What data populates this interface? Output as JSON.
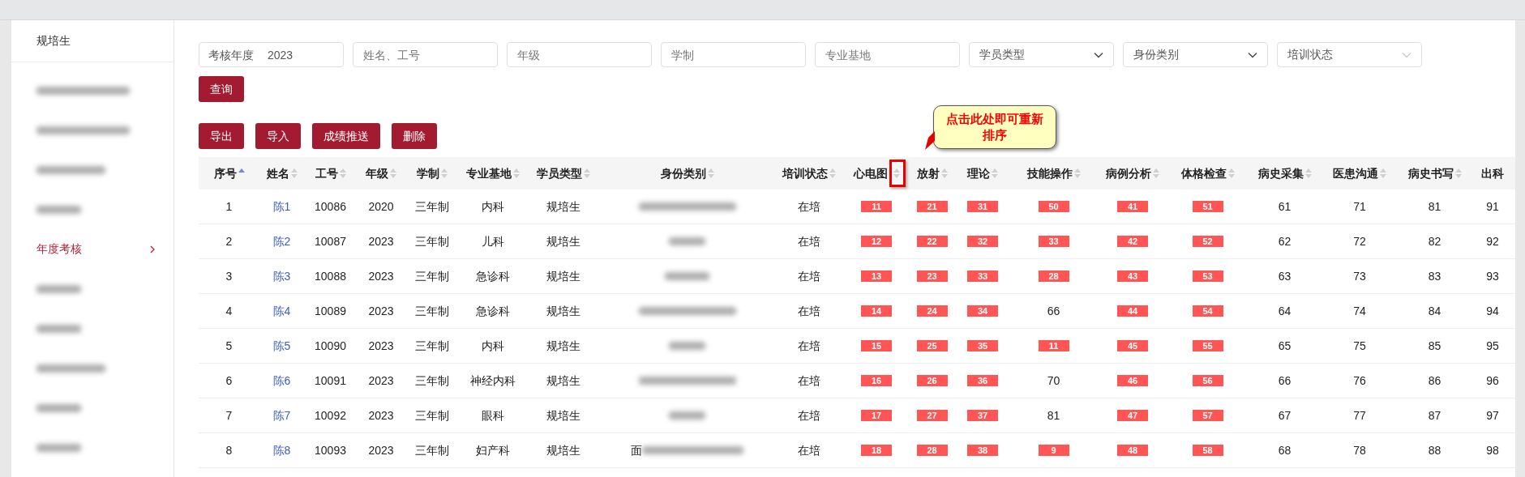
{
  "sidebar": {
    "title": "规培生",
    "items": [
      {
        "kind": "blurred",
        "selected": false
      },
      {
        "kind": "blurred",
        "selected": false
      },
      {
        "kind": "blurred",
        "selected": false
      },
      {
        "kind": "blurred",
        "selected": false
      },
      {
        "kind": "text",
        "label": "年度考核",
        "selected": true
      },
      {
        "kind": "blurred",
        "selected": false
      },
      {
        "kind": "blurred",
        "selected": false
      },
      {
        "kind": "blurred",
        "selected": false
      },
      {
        "kind": "blurred",
        "selected": false
      },
      {
        "kind": "blurred",
        "selected": false
      }
    ]
  },
  "filters": [
    {
      "kind": "input",
      "label": "考核年度",
      "value": "2023"
    },
    {
      "kind": "input",
      "placeholder": "姓名、工号"
    },
    {
      "kind": "input",
      "placeholder": "年级"
    },
    {
      "kind": "input",
      "placeholder": "学制"
    },
    {
      "kind": "input",
      "placeholder": "专业基地"
    },
    {
      "kind": "select",
      "placeholder": "学员类型",
      "disabled": false
    },
    {
      "kind": "select",
      "placeholder": "身份类别",
      "disabled": false
    },
    {
      "kind": "select",
      "placeholder": "培训状态",
      "disabled": true
    }
  ],
  "query_button": "查询",
  "actions": [
    "导出",
    "导入",
    "成绩推送",
    "删除"
  ],
  "callout": "点击此处即可重新排序",
  "table": {
    "columns": [
      {
        "label": "序号",
        "sorted": true
      },
      {
        "label": "姓名",
        "sorted": false
      },
      {
        "label": "工号",
        "sorted": false
      },
      {
        "label": "年级",
        "sorted": false
      },
      {
        "label": "学制",
        "sorted": false
      },
      {
        "label": "专业基地",
        "sorted": false
      },
      {
        "label": "学员类型",
        "sorted": false
      },
      {
        "label": "身份类别",
        "sorted": false
      },
      {
        "label": "培训状态",
        "sorted": false
      },
      {
        "label": "心电图",
        "sorted": false,
        "highlighted": true
      },
      {
        "label": "放射",
        "sorted": false
      },
      {
        "label": "理论",
        "sorted": false
      },
      {
        "label": "技能操作",
        "sorted": false
      },
      {
        "label": "病例分析",
        "sorted": false
      },
      {
        "label": "体格检查",
        "sorted": false
      },
      {
        "label": "病史采集",
        "sorted": false
      },
      {
        "label": "医患沟通",
        "sorted": false
      },
      {
        "label": "病史书写",
        "sorted": false
      },
      {
        "label": "出科"
      }
    ],
    "rows": [
      {
        "cells": [
          "1",
          "陈1",
          "10086",
          "2020",
          "三年制",
          "内科",
          "规培生"
        ],
        "status": "在培",
        "scores": [
          {
            "value": "11",
            "failed": true
          },
          {
            "value": "21",
            "failed": true
          },
          {
            "value": "31",
            "failed": true
          },
          {
            "value": "50",
            "failed": true
          },
          {
            "value": "41",
            "failed": true
          },
          {
            "value": "51",
            "failed": true
          },
          {
            "value": "61",
            "failed": false
          },
          {
            "value": "71",
            "failed": false
          },
          {
            "value": "81",
            "failed": false
          },
          {
            "value": "91",
            "failed": false
          }
        ]
      },
      {
        "cells": [
          "2",
          "陈2",
          "10087",
          "2023",
          "三年制",
          "儿科",
          "规培生"
        ],
        "status": "在培",
        "scores": [
          {
            "value": "12",
            "failed": true
          },
          {
            "value": "22",
            "failed": true
          },
          {
            "value": "32",
            "failed": true
          },
          {
            "value": "33",
            "failed": true
          },
          {
            "value": "42",
            "failed": true
          },
          {
            "value": "52",
            "failed": true
          },
          {
            "value": "62",
            "failed": false
          },
          {
            "value": "72",
            "failed": false
          },
          {
            "value": "82",
            "failed": false
          },
          {
            "value": "92",
            "failed": false
          }
        ]
      },
      {
        "cells": [
          "3",
          "陈3",
          "10088",
          "2023",
          "三年制",
          "急诊科",
          "规培生"
        ],
        "status": "在培",
        "scores": [
          {
            "value": "13",
            "failed": true
          },
          {
            "value": "23",
            "failed": true
          },
          {
            "value": "33",
            "failed": true
          },
          {
            "value": "28",
            "failed": true
          },
          {
            "value": "43",
            "failed": true
          },
          {
            "value": "53",
            "failed": true
          },
          {
            "value": "63",
            "failed": false
          },
          {
            "value": "73",
            "failed": false
          },
          {
            "value": "83",
            "failed": false
          },
          {
            "value": "93",
            "failed": false
          }
        ]
      },
      {
        "cells": [
          "4",
          "陈4",
          "10089",
          "2023",
          "三年制",
          "急诊科",
          "规培生"
        ],
        "status": "在培",
        "scores": [
          {
            "value": "14",
            "failed": true
          },
          {
            "value": "24",
            "failed": true
          },
          {
            "value": "34",
            "failed": true
          },
          {
            "value": "66",
            "failed": false
          },
          {
            "value": "44",
            "failed": true
          },
          {
            "value": "54",
            "failed": true
          },
          {
            "value": "64",
            "failed": false
          },
          {
            "value": "74",
            "failed": false
          },
          {
            "value": "84",
            "failed": false
          },
          {
            "value": "94",
            "failed": false
          }
        ]
      },
      {
        "cells": [
          "5",
          "陈5",
          "10090",
          "2023",
          "三年制",
          "内科",
          "规培生"
        ],
        "status": "在培",
        "scores": [
          {
            "value": "15",
            "failed": true
          },
          {
            "value": "25",
            "failed": true
          },
          {
            "value": "35",
            "failed": true
          },
          {
            "value": "11",
            "failed": true
          },
          {
            "value": "45",
            "failed": true
          },
          {
            "value": "55",
            "failed": true
          },
          {
            "value": "65",
            "failed": false
          },
          {
            "value": "75",
            "failed": false
          },
          {
            "value": "85",
            "failed": false
          },
          {
            "value": "95",
            "failed": false
          }
        ]
      },
      {
        "cells": [
          "6",
          "陈6",
          "10091",
          "2023",
          "三年制",
          "神经内科",
          "规培生"
        ],
        "status": "在培",
        "scores": [
          {
            "value": "16",
            "failed": true
          },
          {
            "value": "26",
            "failed": true
          },
          {
            "value": "36",
            "failed": true
          },
          {
            "value": "70",
            "failed": false
          },
          {
            "value": "46",
            "failed": true
          },
          {
            "value": "56",
            "failed": true
          },
          {
            "value": "66",
            "failed": false
          },
          {
            "value": "76",
            "failed": false
          },
          {
            "value": "86",
            "failed": false
          },
          {
            "value": "96",
            "failed": false
          }
        ]
      },
      {
        "cells": [
          "7",
          "陈7",
          "10092",
          "2023",
          "三年制",
          "眼科",
          "规培生"
        ],
        "status": "在培",
        "scores": [
          {
            "value": "17",
            "failed": true
          },
          {
            "value": "27",
            "failed": true
          },
          {
            "value": "37",
            "failed": true
          },
          {
            "value": "81",
            "failed": false
          },
          {
            "value": "47",
            "failed": true
          },
          {
            "value": "57",
            "failed": true
          },
          {
            "value": "67",
            "failed": false
          },
          {
            "value": "77",
            "failed": false
          },
          {
            "value": "87",
            "failed": false
          },
          {
            "value": "97",
            "failed": false
          }
        ]
      },
      {
        "cells": [
          "8",
          "陈8",
          "10093",
          "2023",
          "三年制",
          "妇产科",
          "规培生"
        ],
        "identity_prefix": "面",
        "status": "在培",
        "scores": [
          {
            "value": "18",
            "failed": true
          },
          {
            "value": "28",
            "failed": true
          },
          {
            "value": "38",
            "failed": true
          },
          {
            "value": "9",
            "failed": true
          },
          {
            "value": "48",
            "failed": true
          },
          {
            "value": "58",
            "failed": true
          },
          {
            "value": "68",
            "failed": false
          },
          {
            "value": "78",
            "failed": false
          },
          {
            "value": "88",
            "failed": false
          },
          {
            "value": "98",
            "failed": false
          }
        ]
      }
    ]
  }
}
